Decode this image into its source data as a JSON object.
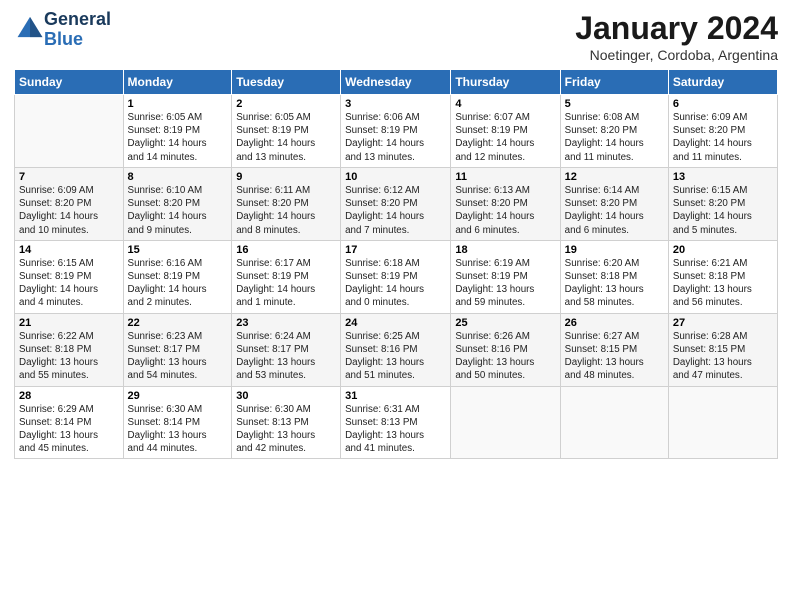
{
  "header": {
    "logo_line1": "General",
    "logo_line2": "Blue",
    "title": "January 2024",
    "subtitle": "Noetinger, Cordoba, Argentina"
  },
  "calendar": {
    "days_of_week": [
      "Sunday",
      "Monday",
      "Tuesday",
      "Wednesday",
      "Thursday",
      "Friday",
      "Saturday"
    ],
    "weeks": [
      [
        {
          "day": "",
          "info": ""
        },
        {
          "day": "1",
          "info": "Sunrise: 6:05 AM\nSunset: 8:19 PM\nDaylight: 14 hours\nand 14 minutes."
        },
        {
          "day": "2",
          "info": "Sunrise: 6:05 AM\nSunset: 8:19 PM\nDaylight: 14 hours\nand 13 minutes."
        },
        {
          "day": "3",
          "info": "Sunrise: 6:06 AM\nSunset: 8:19 PM\nDaylight: 14 hours\nand 13 minutes."
        },
        {
          "day": "4",
          "info": "Sunrise: 6:07 AM\nSunset: 8:19 PM\nDaylight: 14 hours\nand 12 minutes."
        },
        {
          "day": "5",
          "info": "Sunrise: 6:08 AM\nSunset: 8:20 PM\nDaylight: 14 hours\nand 11 minutes."
        },
        {
          "day": "6",
          "info": "Sunrise: 6:09 AM\nSunset: 8:20 PM\nDaylight: 14 hours\nand 11 minutes."
        }
      ],
      [
        {
          "day": "7",
          "info": "Sunrise: 6:09 AM\nSunset: 8:20 PM\nDaylight: 14 hours\nand 10 minutes."
        },
        {
          "day": "8",
          "info": "Sunrise: 6:10 AM\nSunset: 8:20 PM\nDaylight: 14 hours\nand 9 minutes."
        },
        {
          "day": "9",
          "info": "Sunrise: 6:11 AM\nSunset: 8:20 PM\nDaylight: 14 hours\nand 8 minutes."
        },
        {
          "day": "10",
          "info": "Sunrise: 6:12 AM\nSunset: 8:20 PM\nDaylight: 14 hours\nand 7 minutes."
        },
        {
          "day": "11",
          "info": "Sunrise: 6:13 AM\nSunset: 8:20 PM\nDaylight: 14 hours\nand 6 minutes."
        },
        {
          "day": "12",
          "info": "Sunrise: 6:14 AM\nSunset: 8:20 PM\nDaylight: 14 hours\nand 6 minutes."
        },
        {
          "day": "13",
          "info": "Sunrise: 6:15 AM\nSunset: 8:20 PM\nDaylight: 14 hours\nand 5 minutes."
        }
      ],
      [
        {
          "day": "14",
          "info": "Sunrise: 6:15 AM\nSunset: 8:19 PM\nDaylight: 14 hours\nand 4 minutes."
        },
        {
          "day": "15",
          "info": "Sunrise: 6:16 AM\nSunset: 8:19 PM\nDaylight: 14 hours\nand 2 minutes."
        },
        {
          "day": "16",
          "info": "Sunrise: 6:17 AM\nSunset: 8:19 PM\nDaylight: 14 hours\nand 1 minute."
        },
        {
          "day": "17",
          "info": "Sunrise: 6:18 AM\nSunset: 8:19 PM\nDaylight: 14 hours\nand 0 minutes."
        },
        {
          "day": "18",
          "info": "Sunrise: 6:19 AM\nSunset: 8:19 PM\nDaylight: 13 hours\nand 59 minutes."
        },
        {
          "day": "19",
          "info": "Sunrise: 6:20 AM\nSunset: 8:18 PM\nDaylight: 13 hours\nand 58 minutes."
        },
        {
          "day": "20",
          "info": "Sunrise: 6:21 AM\nSunset: 8:18 PM\nDaylight: 13 hours\nand 56 minutes."
        }
      ],
      [
        {
          "day": "21",
          "info": "Sunrise: 6:22 AM\nSunset: 8:18 PM\nDaylight: 13 hours\nand 55 minutes."
        },
        {
          "day": "22",
          "info": "Sunrise: 6:23 AM\nSunset: 8:17 PM\nDaylight: 13 hours\nand 54 minutes."
        },
        {
          "day": "23",
          "info": "Sunrise: 6:24 AM\nSunset: 8:17 PM\nDaylight: 13 hours\nand 53 minutes."
        },
        {
          "day": "24",
          "info": "Sunrise: 6:25 AM\nSunset: 8:16 PM\nDaylight: 13 hours\nand 51 minutes."
        },
        {
          "day": "25",
          "info": "Sunrise: 6:26 AM\nSunset: 8:16 PM\nDaylight: 13 hours\nand 50 minutes."
        },
        {
          "day": "26",
          "info": "Sunrise: 6:27 AM\nSunset: 8:15 PM\nDaylight: 13 hours\nand 48 minutes."
        },
        {
          "day": "27",
          "info": "Sunrise: 6:28 AM\nSunset: 8:15 PM\nDaylight: 13 hours\nand 47 minutes."
        }
      ],
      [
        {
          "day": "28",
          "info": "Sunrise: 6:29 AM\nSunset: 8:14 PM\nDaylight: 13 hours\nand 45 minutes."
        },
        {
          "day": "29",
          "info": "Sunrise: 6:30 AM\nSunset: 8:14 PM\nDaylight: 13 hours\nand 44 minutes."
        },
        {
          "day": "30",
          "info": "Sunrise: 6:30 AM\nSunset: 8:13 PM\nDaylight: 13 hours\nand 42 minutes."
        },
        {
          "day": "31",
          "info": "Sunrise: 6:31 AM\nSunset: 8:13 PM\nDaylight: 13 hours\nand 41 minutes."
        },
        {
          "day": "",
          "info": ""
        },
        {
          "day": "",
          "info": ""
        },
        {
          "day": "",
          "info": ""
        }
      ]
    ]
  }
}
